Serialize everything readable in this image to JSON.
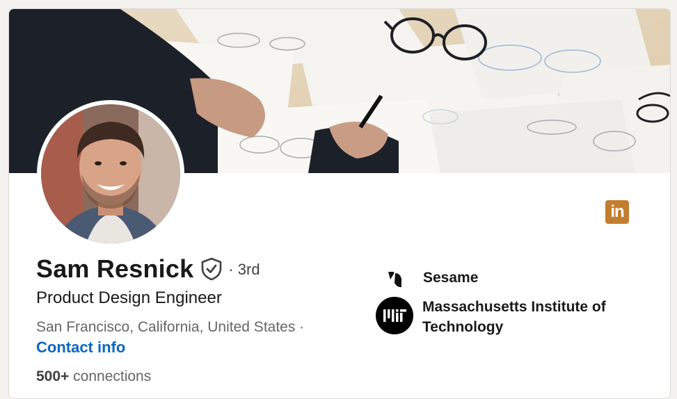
{
  "profile": {
    "name": "Sam Resnick",
    "degree": "· 3rd",
    "headline": "Product Design Engineer",
    "location": "San Francisco, California, United States ·",
    "contact_label": "Contact info",
    "connections_count": "500+",
    "connections_label": "connections"
  },
  "brand": {
    "logo_text": "in",
    "color": "#c37d2e"
  },
  "orgs": [
    {
      "name": "Sesame",
      "icon": "sesame-logo-icon"
    },
    {
      "name": "Massachusetts Institute of Technology",
      "icon": "mit-logo-icon"
    }
  ],
  "colors": {
    "link": "#0a66c2",
    "text": "#191919",
    "muted": "#666666"
  }
}
